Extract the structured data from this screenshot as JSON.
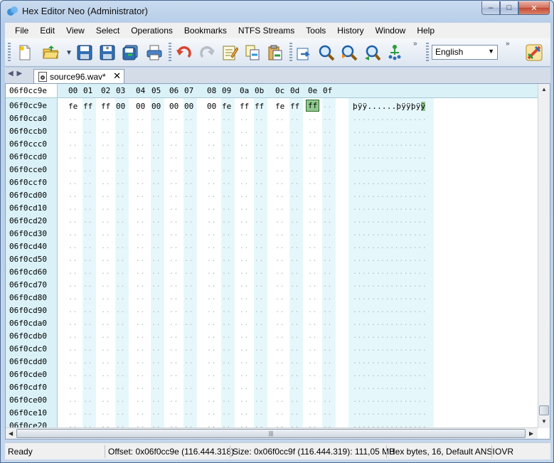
{
  "window": {
    "title": "Hex Editor Neo (Administrator)",
    "controls": {
      "minimize": "–",
      "maximize": "□",
      "close": "✕"
    }
  },
  "menu": [
    "File",
    "Edit",
    "View",
    "Select",
    "Operations",
    "Bookmarks",
    "NTFS Streams",
    "Tools",
    "History",
    "Window",
    "Help"
  ],
  "toolbar": {
    "language": "English",
    "icons": [
      "new-file-icon",
      "open-folder-icon",
      "save-icon",
      "save-as-icon",
      "save-all-icon",
      "print-icon",
      "undo-icon",
      "redo-icon",
      "edit-notes-icon",
      "copy-icon",
      "paste-icon",
      "goto-icon",
      "find-icon",
      "find-next-icon",
      "find-prev-icon",
      "structure-icon",
      "settings-icon"
    ]
  },
  "tab": {
    "label": "source96.wav*",
    "close": "✕"
  },
  "editor": {
    "header_offset": "06f0cc9e",
    "columns": [
      "00",
      "01",
      "02",
      "03",
      "04",
      "05",
      "06",
      "07",
      "08",
      "09",
      "0a",
      "0b",
      "0c",
      "0d",
      "0e",
      "0f"
    ],
    "first_row": {
      "offset": "06f0cc9e",
      "bytes": [
        "fe",
        "ff",
        "ff",
        "00",
        "00",
        "00",
        "00",
        "00",
        "00",
        "fe",
        "ff",
        "ff",
        "fe",
        "ff",
        "ff",
        ".."
      ],
      "text_before": "þÿÿ......þÿÿþÿ",
      "text_selected": "ÿ",
      "selected_index": 14
    },
    "offsets": [
      "06f0cca0",
      "06f0ccb0",
      "06f0ccc0",
      "06f0ccd0",
      "06f0cce0",
      "06f0ccf0",
      "06f0cd00",
      "06f0cd10",
      "06f0cd20",
      "06f0cd30",
      "06f0cd40",
      "06f0cd50",
      "06f0cd60",
      "06f0cd70",
      "06f0cd80",
      "06f0cd90",
      "06f0cda0",
      "06f0cdb0",
      "06f0cdc0",
      "06f0cdd0",
      "06f0cde0",
      "06f0cdf0",
      "06f0ce00",
      "06f0ce10",
      "06f0ce20"
    ],
    "empty_cell": "..",
    "empty_text": "................"
  },
  "status": {
    "state": "Ready",
    "offset": "Offset: 0x06f0cc9e (116.444.318)",
    "size": "Size: 0x06f0cc9f (116.444.319): 111,05 MB",
    "mode": "Hex bytes, 16, Default ANSI",
    "ovr": "OVR"
  },
  "colors": {
    "accent_green": "#8fc88f",
    "stripe_cyan": "#e6f7fb",
    "header_cyan": "#d9f1f7"
  }
}
